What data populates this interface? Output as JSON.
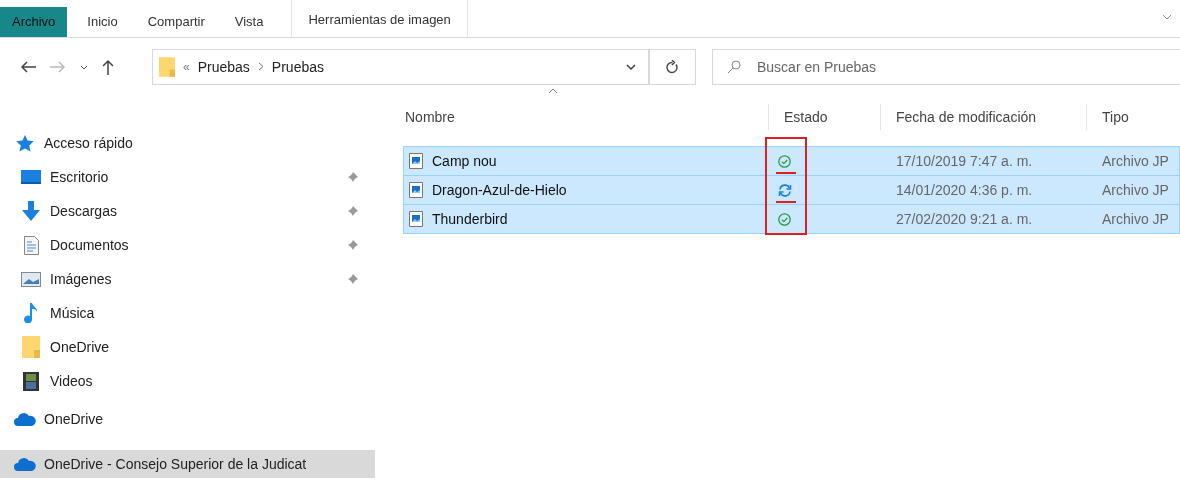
{
  "ribbon": {
    "tabs": [
      {
        "label": "Archivo",
        "kind": "file",
        "selected": true
      },
      {
        "label": "Inicio",
        "kind": "tab",
        "selected": false
      },
      {
        "label": "Compartir",
        "kind": "tab",
        "selected": false
      },
      {
        "label": "Vista",
        "kind": "tab",
        "selected": false
      },
      {
        "label": "Herramientas de imagen",
        "kind": "context",
        "selected": false
      }
    ]
  },
  "address_bar": {
    "crumbs": [
      "«",
      "Pruebas",
      "Pruebas"
    ],
    "forward_disabled": true
  },
  "search": {
    "placeholder": "Buscar en Pruebas"
  },
  "nav": {
    "items": [
      {
        "label": "Acceso rápido",
        "kind": "star",
        "pinned": false,
        "selected": false,
        "children": [
          {
            "label": "Escritorio",
            "kind": "desktop",
            "pinned": true,
            "selected": false
          },
          {
            "label": "Descargas",
            "kind": "download",
            "pinned": true,
            "selected": false
          },
          {
            "label": "Documentos",
            "kind": "document",
            "pinned": true,
            "selected": false
          },
          {
            "label": "Imágenes",
            "kind": "pictures",
            "pinned": true,
            "selected": false
          },
          {
            "label": "Música",
            "kind": "music",
            "pinned": false,
            "selected": false
          },
          {
            "label": "OneDrive",
            "kind": "folder",
            "pinned": false,
            "selected": false
          },
          {
            "label": "Videos",
            "kind": "video",
            "pinned": false,
            "selected": false
          }
        ]
      },
      {
        "label": "OneDrive",
        "kind": "cloud",
        "pinned": false,
        "selected": false
      },
      {
        "label": "OneDrive - Consejo Superior de la Judicat",
        "kind": "cloud",
        "pinned": false,
        "selected": true
      }
    ]
  },
  "table": {
    "columns": [
      {
        "label": "Nombre",
        "sorted": true
      },
      {
        "label": "Estado",
        "sorted": false
      },
      {
        "label": "Fecha de modificación",
        "sorted": false
      },
      {
        "label": "Tipo",
        "sorted": false
      }
    ],
    "rows": [
      {
        "name": "Camp nou",
        "kind": "synced",
        "date": "17/10/2019 7:47 a. m.",
        "type": "Archivo JP",
        "selected": true,
        "underlined": true
      },
      {
        "name": "Dragon-Azul-de-Hielo",
        "kind": "syncing",
        "date": "14/01/2020 4:36 p. m.",
        "type": "Archivo JP",
        "selected": true,
        "underlined": true
      },
      {
        "name": "Thunderbird",
        "kind": "synced",
        "date": "27/02/2020 9:21 a. m.",
        "type": "Archivo JP",
        "selected": true,
        "underlined": false
      }
    ],
    "status_highlight": true
  }
}
